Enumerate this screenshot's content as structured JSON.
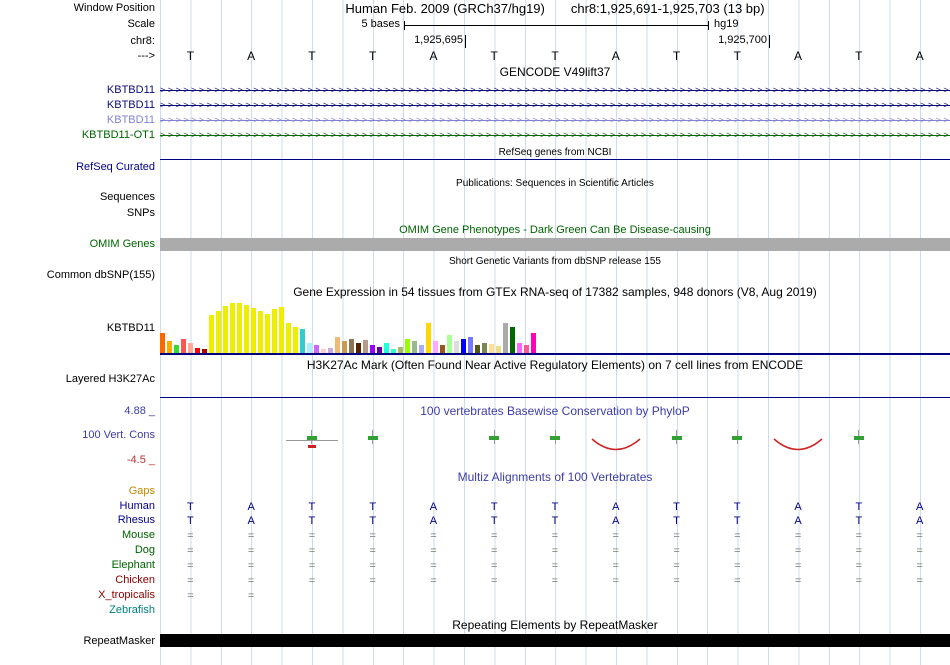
{
  "header": {
    "window_position_label": "Window Position",
    "assembly": "Human Feb. 2009 (GRCh37/hg19)",
    "range": "chr8:1,925,691-1,925,703 (13 bp)",
    "scale_label": "Scale",
    "scale_bases": "5 bases",
    "genome": "hg19",
    "chrom_label": "chr8:",
    "tick_labels": [
      "1,925,695",
      "1,925,700"
    ],
    "direction_label": "--->",
    "sequence": [
      "T",
      "A",
      "T",
      "T",
      "A",
      "T",
      "T",
      "A",
      "T",
      "T",
      "A",
      "T",
      "A"
    ]
  },
  "tracks": {
    "gencode": {
      "title": "GENCODE V49lift37",
      "arrow_glyph": ">",
      "items": [
        {
          "label": "KBTBD11",
          "color": "#0C0C78"
        },
        {
          "label": "KBTBD11",
          "color": "#0C0C78"
        },
        {
          "label": "KBTBD11",
          "color": "#8282D2"
        },
        {
          "label": "KBTBD11-OT1",
          "color": "#006400"
        }
      ]
    },
    "refseq": {
      "title": "RefSeq genes from NCBI",
      "label": "RefSeq Curated",
      "color": "#00008B"
    },
    "publications": {
      "title": "Publications: Sequences in Scientific Articles",
      "labels": [
        "Sequences",
        "SNPs"
      ]
    },
    "omim": {
      "title": "OMIM Gene Phenotypes - Dark Green Can Be Disease-causing",
      "label": "OMIM Genes",
      "color": "#006400",
      "bar_color": "#ABABAB"
    },
    "dbsnp": {
      "title": "Short Genetic Variants from dbSNP release 155",
      "label": "Common dbSNP(155)"
    },
    "gtex": {
      "title": "Gene Expression in 54 tissues from GTEx RNA-seq of 17382 samples, 948 donors (V8, Aug 2019)",
      "label": "KBTBD11"
    },
    "h3k27ac": {
      "title": "H3K27Ac Mark (Often Found Near Active Regulatory Elements) on 7 cell lines from ENCODE",
      "label": "Layered H3K27Ac"
    },
    "conservation": {
      "title": "100 vertebrates Basewise Conservation by PhyloP",
      "label": "100 Vert. Cons",
      "max_label": "4.88 _",
      "min_label": "-4.5 _",
      "color": "#3C3CA8"
    },
    "multiz": {
      "title": "Multiz Alignments of 100 Vertebrates",
      "species": [
        {
          "name": "Gaps",
          "label_color": "#C08A00",
          "row_color": "#708070",
          "row": [
            "",
            "",
            "",
            "",
            "",
            "",
            "",
            "",
            "",
            "",
            "",
            "",
            ""
          ]
        },
        {
          "name": "Human",
          "label_color": "#00008B",
          "row_color": "#00008B",
          "row": [
            "T",
            "A",
            "T",
            "T",
            "A",
            "T",
            "T",
            "A",
            "T",
            "T",
            "A",
            "T",
            "A"
          ]
        },
        {
          "name": "Rhesus",
          "label_color": "#00008B",
          "row_color": "#00008B",
          "row": [
            "T",
            "A",
            "T",
            "T",
            "A",
            "T",
            "T",
            "A",
            "T",
            "T",
            "A",
            "T",
            "A"
          ]
        },
        {
          "name": "Mouse",
          "label_color": "#006400",
          "row_color": "#708070",
          "row": [
            "=",
            "=",
            "=",
            "=",
            "=",
            "=",
            "=",
            "=",
            "=",
            "=",
            "=",
            "=",
            "="
          ]
        },
        {
          "name": "Dog",
          "label_color": "#006400",
          "row_color": "#708070",
          "row": [
            "=",
            "=",
            "=",
            "=",
            "=",
            "=",
            "=",
            "=",
            "=",
            "=",
            "=",
            "=",
            "="
          ]
        },
        {
          "name": "Elephant",
          "label_color": "#006400",
          "row_color": "#708070",
          "row": [
            "=",
            "=",
            "=",
            "=",
            "=",
            "=",
            "=",
            "=",
            "=",
            "=",
            "=",
            "=",
            "="
          ]
        },
        {
          "name": "Chicken",
          "label_color": "#8B0000",
          "row_color": "#708070",
          "row": [
            "=",
            "=",
            "=",
            "=",
            "=",
            "=",
            "=",
            "=",
            "=",
            "=",
            "=",
            "=",
            "="
          ]
        },
        {
          "name": "X_tropicalis",
          "label_color": "#8B0000",
          "row_color": "#708070",
          "row": [
            "=",
            "=",
            "",
            "",
            "",
            "",
            "",
            "",
            "",
            "",
            "",
            "",
            ""
          ]
        },
        {
          "name": "Zebrafish",
          "label_color": "#008080",
          "row_color": "#708070",
          "row": [
            "",
            "",
            "",
            "",
            "",
            "",
            "",
            "",
            "",
            "",
            "",
            "",
            ""
          ]
        }
      ]
    },
    "repeatmasker": {
      "title": "Repeating Elements by RepeatMasker",
      "label": "RepeatMasker",
      "bar_color": "#000000"
    }
  },
  "chart_data": [
    {
      "type": "bar",
      "title": "Gene Expression in 54 tissues from GTEx RNA-seq of 17382 samples, 948 donors (V8, Aug 2019)",
      "series_label": "KBTBD11",
      "ylabel": "expression (unlabeled axis, bar heights estimated in px)",
      "values": [
        20,
        12,
        8,
        14,
        10,
        5,
        4,
        38,
        42,
        47,
        50,
        50,
        48,
        45,
        42,
        39,
        44,
        46,
        30,
        26,
        24,
        10,
        8,
        4,
        5,
        16,
        12,
        14,
        10,
        13,
        8,
        6,
        10,
        4,
        6,
        14,
        12,
        8,
        30,
        12,
        8,
        18,
        12,
        14,
        16,
        8,
        10,
        9,
        7,
        30,
        26,
        10,
        8,
        20
      ],
      "colors": [
        "#FF6600",
        "#FFAA00",
        "#33DD33",
        "#FF5555",
        "#FFAA99",
        "#FF0000",
        "#AA0000",
        "#EEEE00",
        "#EEEE00",
        "#EEEE00",
        "#EEEE00",
        "#EEEE00",
        "#EEEE00",
        "#EEEE00",
        "#EEEE00",
        "#EEEE00",
        "#EEEE00",
        "#EEEE00",
        "#EEEE00",
        "#EEEE00",
        "#33CCCC",
        "#AAEEFF",
        "#CC66FF",
        "#FFCCCC",
        "#CCAADD",
        "#EEBB77",
        "#CC9955",
        "#8B7355",
        "#552200",
        "#BB9988",
        "#9900FF",
        "#660099",
        "#22FFDD",
        "#33FFC2",
        "#AABB66",
        "#99FF00",
        "#99BB88",
        "#AAAAFF",
        "#FFD700",
        "#FFAAFF",
        "#995522",
        "#AAFF99",
        "#DDDDDD",
        "#0000FF",
        "#7777FF",
        "#555522",
        "#778855",
        "#FFDD99",
        "#EEDD88",
        "#AAAAAA",
        "#006600",
        "#FF66FF",
        "#FF5599",
        "#FF00BB"
      ]
    },
    {
      "type": "bar",
      "title": "100 vertebrates Basewise Conservation by PhyloP",
      "x_positions": [
        1925691,
        1925692,
        1925693,
        1925694,
        1925695,
        1925696,
        1925697,
        1925698,
        1925699,
        1925700,
        1925701,
        1925702,
        1925703
      ],
      "values": [
        0,
        0,
        0.5,
        0.3,
        0,
        0.3,
        0.3,
        -2,
        0.3,
        0.3,
        -2,
        0.3,
        0
      ],
      "ylim": [
        -4.5,
        4.88
      ],
      "detail_base_index": 2
    }
  ],
  "colors": {
    "gridline": "#cbdcee",
    "track_line": "#000080",
    "cons_pos": "#33A033",
    "cons_neg": "#CC2222",
    "whisker": "#999999"
  }
}
